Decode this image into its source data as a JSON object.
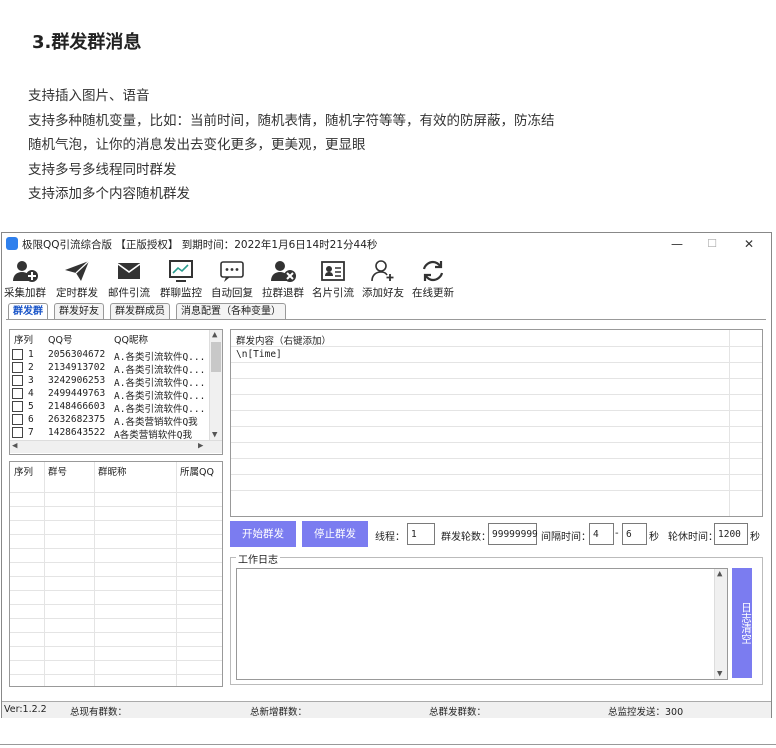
{
  "doc": {
    "title": "3.群发群消息",
    "lines": [
      "支持插入图片、语音",
      "支持多种随机变量，比如：当前时间，随机表情，随机字符等等，有效的防屏蔽，防冻结",
      "随机气泡，让你的消息发出去变化更多，更美观，更显眼",
      "支持多号多线程同时群发",
      "支持添加多个内容随机群发"
    ]
  },
  "window": {
    "title": "极限QQ引流综合版 【正版授权】 到期时间：2022年1月6日14时21分44秒",
    "min": "—",
    "max": "☐",
    "close": "✕"
  },
  "toolbar": {
    "items": [
      {
        "label": "采集加群",
        "icon": "users-plus-icon"
      },
      {
        "label": "定时群发",
        "icon": "paper-plane-icon"
      },
      {
        "label": "邮件引流",
        "icon": "envelope-icon"
      },
      {
        "label": "群聊监控",
        "icon": "monitor-chart-icon"
      },
      {
        "label": "自动回复",
        "icon": "chat-bubble-icon"
      },
      {
        "label": "拉群退群",
        "icon": "users-remove-icon"
      },
      {
        "label": "名片引流",
        "icon": "id-card-icon"
      },
      {
        "label": "添加好友",
        "icon": "user-add-icon"
      },
      {
        "label": "在线更新",
        "icon": "refresh-icon"
      }
    ]
  },
  "tabs": [
    "群发群",
    "群发好友",
    "群发群成员",
    "消息配置（各种变量）"
  ],
  "qq_table": {
    "headers": [
      "序列",
      "QQ号",
      "QQ昵称"
    ],
    "rows": [
      [
        "1",
        "2056304672",
        "A.各类引流软件Q..."
      ],
      [
        "2",
        "2134913702",
        "A.各类引流软件Q..."
      ],
      [
        "3",
        "3242906253",
        "A.各类引流软件Q..."
      ],
      [
        "4",
        "2499449763",
        "A.各类引流软件Q..."
      ],
      [
        "5",
        "2148466603",
        "A.各类引流软件Q..."
      ],
      [
        "6",
        "2632682375",
        "A.各类营销软件Q我"
      ],
      [
        "7",
        "1428643522",
        "A各类营销软件Q我"
      ]
    ]
  },
  "group_table": {
    "headers": [
      "序列",
      "群号",
      "群昵称",
      "所属QQ"
    ]
  },
  "content": {
    "header": "群发内容（右键添加）",
    "line1": "\\n[Time]"
  },
  "controls": {
    "start": "开始群发",
    "stop": "停止群发",
    "threads_label": "线程：",
    "threads": "1",
    "rounds_label": "群发轮数：",
    "rounds": "99999999",
    "interval_label": "间隔时间：",
    "interval_min": "4",
    "dash": "-",
    "interval_max": "6",
    "sec1": "秒",
    "rest_label": "轮休时间：",
    "rest": "1200",
    "sec2": "秒"
  },
  "log": {
    "title": "工作日志",
    "clear": "日志清空"
  },
  "status": {
    "version": "Ver:1.2.2",
    "total_groups": "总现有群数：",
    "new_groups": "总新增群数：",
    "sent_groups": "总群发群数：",
    "monitor": "总监控发送：300"
  },
  "colors": {
    "accent": "#7b7cf0",
    "tab_active": "#1a55c8"
  }
}
